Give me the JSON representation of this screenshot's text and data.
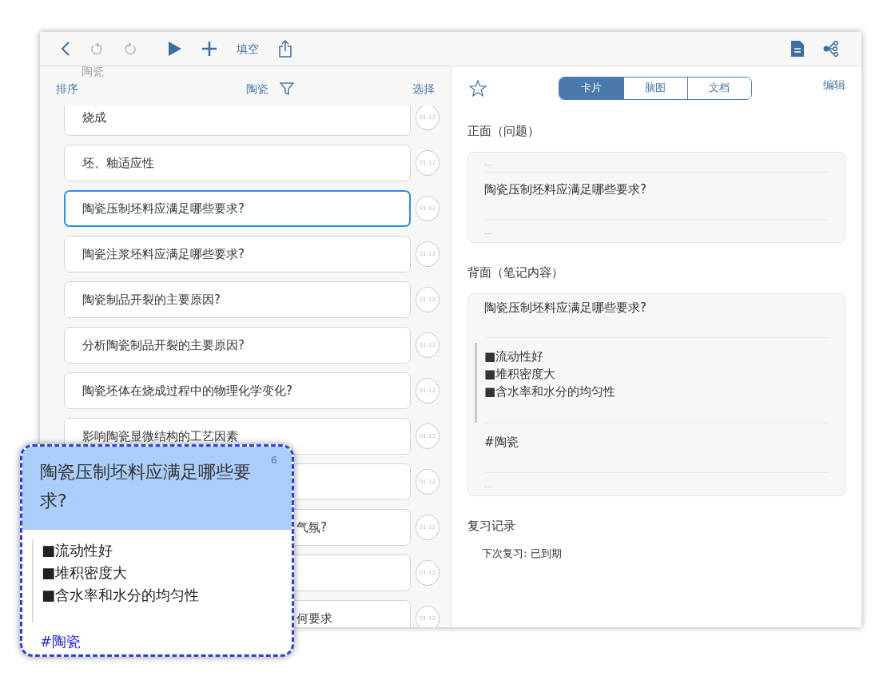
{
  "toolbar": {
    "left": [
      {
        "kind": "back",
        "disabled": false
      },
      {
        "kind": "undo",
        "disabled": true
      },
      {
        "kind": "redo",
        "disabled": true
      },
      {
        "kind": "play",
        "disabled": false
      },
      {
        "kind": "add",
        "disabled": false
      },
      {
        "kind": "text",
        "label": "填空",
        "disabled": false
      },
      {
        "kind": "share",
        "disabled": false
      }
    ],
    "right": [
      {
        "kind": "document",
        "disabled": false
      },
      {
        "kind": "mindmap",
        "disabled": false
      }
    ]
  },
  "list_header": {
    "ghost_title": "陶瓷",
    "sort": "排序",
    "filter": "陶瓷",
    "select": "选择"
  },
  "notes": [
    {
      "kind": "full",
      "text": "烧成",
      "date": "01-12",
      "selected": false
    },
    {
      "kind": "full",
      "text": "坯、釉适应性",
      "date": "01-12",
      "selected": false
    },
    {
      "kind": "full",
      "text": "陶瓷压制坯料应满足哪些要求?",
      "date": "01-12",
      "selected": true
    },
    {
      "kind": "full",
      "text": "陶瓷注浆坯料应满足哪些要求?",
      "date": "01-12",
      "selected": false
    },
    {
      "kind": "full",
      "text": "陶瓷制品开裂的主要原因?",
      "date": "01-12",
      "selected": false
    },
    {
      "kind": "full",
      "text": "分析陶瓷制品开裂的主要原因?",
      "date": "01-12",
      "selected": false
    },
    {
      "kind": "full",
      "text": "陶瓷坯体在烧成过程中的物理化学变化?",
      "date": "01-12",
      "selected": false
    },
    {
      "kind": "full",
      "text": "影响陶瓷显微结构的工艺因素",
      "date": "01-12",
      "selected": false
    },
    {
      "kind": "covered",
      "date": "01-12",
      "selected": false
    },
    {
      "kind": "covered",
      "text": "气氛?",
      "date": "01-12",
      "selected": false
    },
    {
      "kind": "covered",
      "date": "01-12",
      "selected": false
    },
    {
      "kind": "covered",
      "text": "何要求",
      "date": "01-12",
      "selected": false
    }
  ],
  "detail": {
    "starred": false,
    "views": [
      {
        "label": "卡片",
        "selected": true
      },
      {
        "label": "脑图",
        "selected": false
      },
      {
        "label": "文档",
        "selected": false
      }
    ],
    "edit": "编辑",
    "front": {
      "heading": "正面（问题）",
      "top": "...",
      "question": "陶瓷压制坯料应满足哪些要求?",
      "bottom": "..."
    },
    "back": {
      "heading": "背面（笔记内容）",
      "question": "陶瓷压制坯料应满足哪些要求?",
      "points": [
        "■流动性好",
        "■堆积密度大",
        "■含水率和水分的均匀性"
      ],
      "tag": "#陶瓷",
      "bottom": "..."
    },
    "review": {
      "heading": "复习记录",
      "next": "下次复习: 已到期"
    }
  },
  "preview": {
    "title": "陶瓷压制坯料应满足哪些要求?",
    "count": "6",
    "points": [
      "■流动性好",
      "■堆积密度大",
      "■含水率和水分的均匀性"
    ],
    "tag": "#陶瓷"
  }
}
